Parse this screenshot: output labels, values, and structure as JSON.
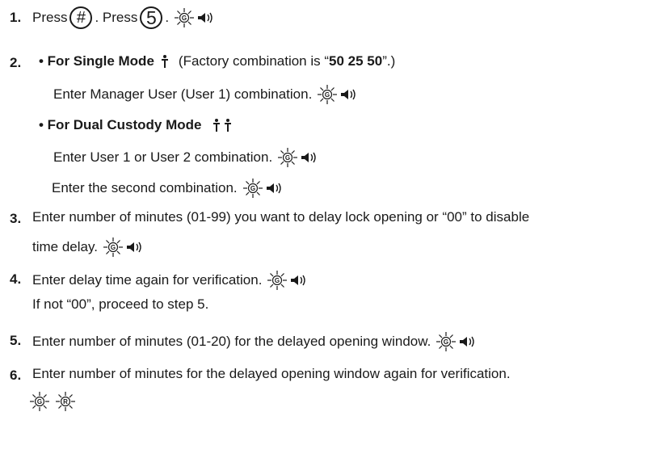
{
  "steps": [
    {
      "num": "1.",
      "text": "Press",
      "text_b": ". Press",
      "key1": "#",
      "key2": "5",
      "text_c": "."
    },
    {
      "num": "2.",
      "single_bullet": "• For Single Mode",
      "single_note_a": "(Factory combination is “",
      "single_note_b": "50 25 50",
      "single_note_c": "”.)",
      "single_line": "Enter Manager User (User 1) combination.",
      "dual_bullet": "• For Dual Custody Mode",
      "dual_line1": "Enter User 1 or User 2 combination.",
      "dual_line2": "Enter the second combination."
    },
    {
      "num": "3.",
      "line1": "Enter number of minutes (01-99) you want to delay lock opening or  “00” to disable",
      "line2": "time delay."
    },
    {
      "num": "4.",
      "line1": "Enter delay time again for verification.",
      "line2": "If not “00”, proceed to step 5."
    },
    {
      "num": "5.",
      "line1": "Enter number of minutes (01-20) for the delayed opening window."
    },
    {
      "num": "6.",
      "line1": "Enter number of minutes for the delayed opening window again for verification."
    }
  ],
  "indicators": {
    "green_led": "G",
    "red_led": "R"
  },
  "icons": [
    "green-led-icon",
    "red-led-icon",
    "speaker-beep-icon",
    "person-icon"
  ],
  "colors": {
    "text": "#1a1a1a",
    "background": "#ffffff"
  }
}
